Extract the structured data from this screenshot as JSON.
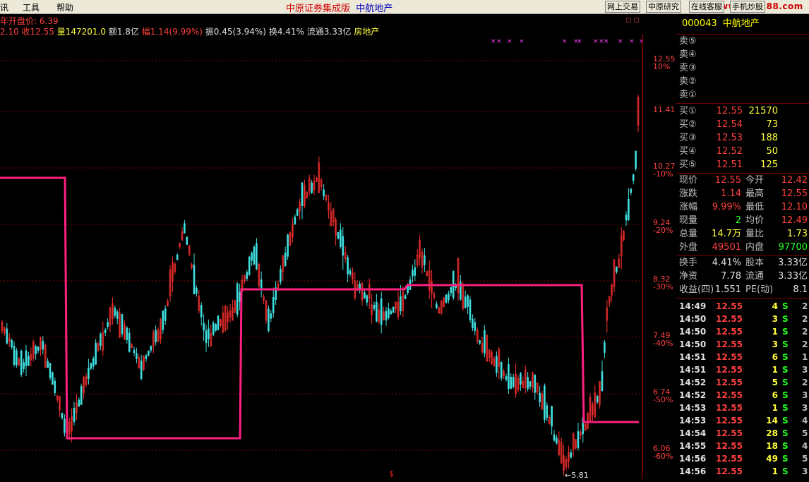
{
  "menu": {
    "items": [
      "讯",
      "工具",
      "帮助"
    ]
  },
  "app_title": {
    "left": "中原证券集成版",
    "right": "中航地产"
  },
  "toolbar_buttons": [
    "网上交易",
    "中原研究",
    "在线客服",
    "手机炒股"
  ],
  "watermark": "www.55188.com",
  "info": {
    "line1": "年开盘价: 6.39",
    "line2_a": "2.10 收12.55",
    "line2_vol": "量147201.0",
    "line2_amt": "额1.8亿",
    "line2_chg": "幅1.14(9.99%)",
    "line2_amp": "振0.45(3.94%)",
    "line2_turn": "换4.41%",
    "line2_float": "流通3.33亿",
    "line2_sector": "房地产"
  },
  "stock": {
    "code": "000043",
    "name": "中航地产"
  },
  "ask": [
    {
      "label": "卖⑤"
    },
    {
      "label": "卖④"
    },
    {
      "label": "卖③"
    },
    {
      "label": "卖②"
    },
    {
      "label": "卖①"
    }
  ],
  "bid": [
    {
      "label": "买①",
      "price": "12.55",
      "vol": "21570"
    },
    {
      "label": "买②",
      "price": "12.54",
      "vol": "73"
    },
    {
      "label": "买③",
      "price": "12.53",
      "vol": "188"
    },
    {
      "label": "买④",
      "price": "12.52",
      "vol": "50"
    },
    {
      "label": "买⑤",
      "price": "12.51",
      "vol": "125"
    }
  ],
  "quote": [
    {
      "l1": "现价",
      "v1": "12.55",
      "l2": "今开",
      "v2": "12.42"
    },
    {
      "l1": "涨跌",
      "v1": "1.14",
      "l2": "最高",
      "v2": "12.55"
    },
    {
      "l1": "涨幅",
      "v1": "9.99%",
      "l2": "最低",
      "v2": "12.10"
    },
    {
      "l1": "现量",
      "v1": "2",
      "l2": "均价",
      "v2": "12.49"
    },
    {
      "l1": "总量",
      "v1": "14.7万",
      "l2": "量比",
      "v2": "1.73"
    },
    {
      "l1": "外盘",
      "v1": "49501",
      "l2": "内盘",
      "v2": "97700"
    }
  ],
  "fund": [
    {
      "l1": "换手",
      "v1": "4.41%",
      "l2": "股本",
      "v2": "3.33亿"
    },
    {
      "l1": "净资",
      "v1": "7.78",
      "l2": "流通",
      "v2": "3.33亿"
    },
    {
      "l1": "收益(四)",
      "v1": "1.551",
      "l2": "PE(动)",
      "v2": "8.1"
    }
  ],
  "ticks": [
    {
      "t": "14:49",
      "p": "12.55",
      "v": "4",
      "s": "S",
      "n": "2"
    },
    {
      "t": "14:50",
      "p": "12.55",
      "v": "3",
      "s": "S",
      "n": "2"
    },
    {
      "t": "14:50",
      "p": "12.55",
      "v": "1",
      "s": "S",
      "n": "2"
    },
    {
      "t": "14:50",
      "p": "12.55",
      "v": "3",
      "s": "S",
      "n": "2"
    },
    {
      "t": "14:51",
      "p": "12.55",
      "v": "6",
      "s": "S",
      "n": "1"
    },
    {
      "t": "14:51",
      "p": "12.55",
      "v": "1",
      "s": "S",
      "n": "3"
    },
    {
      "t": "14:52",
      "p": "12.55",
      "v": "5",
      "s": "S",
      "n": "2"
    },
    {
      "t": "14:52",
      "p": "12.55",
      "v": "6",
      "s": "S",
      "n": "3"
    },
    {
      "t": "14:53",
      "p": "12.55",
      "v": "1",
      "s": "S",
      "n": "3"
    },
    {
      "t": "14:53",
      "p": "12.55",
      "v": "14",
      "s": "S",
      "n": "4"
    },
    {
      "t": "14:54",
      "p": "12.55",
      "v": "28",
      "s": "S",
      "n": "5"
    },
    {
      "t": "14:55",
      "p": "12.55",
      "v": "18",
      "s": "S",
      "n": "4"
    },
    {
      "t": "14:56",
      "p": "12.55",
      "v": "49",
      "s": "S",
      "n": "5"
    },
    {
      "t": "14:56",
      "p": "12.55",
      "v": "1",
      "s": "S",
      "n": "3"
    }
  ],
  "axis_labels": [
    {
      "price": "12.55",
      "pct": "10%"
    },
    {
      "price": "11.41",
      "pct": ""
    },
    {
      "price": "10.27",
      "pct": "-10%"
    },
    {
      "price": "9.24",
      "pct": "-20%"
    },
    {
      "price": "8.32",
      "pct": "-30%"
    },
    {
      "price": "7.49",
      "pct": "-40%"
    },
    {
      "price": "6.74",
      "pct": "-50%"
    },
    {
      "price": "6.06",
      "pct": "-60%"
    }
  ],
  "low_marker": "←5.81",
  "chart_data": {
    "type": "candlestick",
    "y_ticks": [
      12.55,
      11.41,
      10.27,
      9.24,
      8.32,
      7.49,
      6.74,
      6.06
    ],
    "y_range": [
      5.81,
      12.55
    ],
    "colors": {
      "up": "#ff3030",
      "down": "#40e0e0",
      "step_line": "#ff2080",
      "grid": "#800000"
    }
  }
}
